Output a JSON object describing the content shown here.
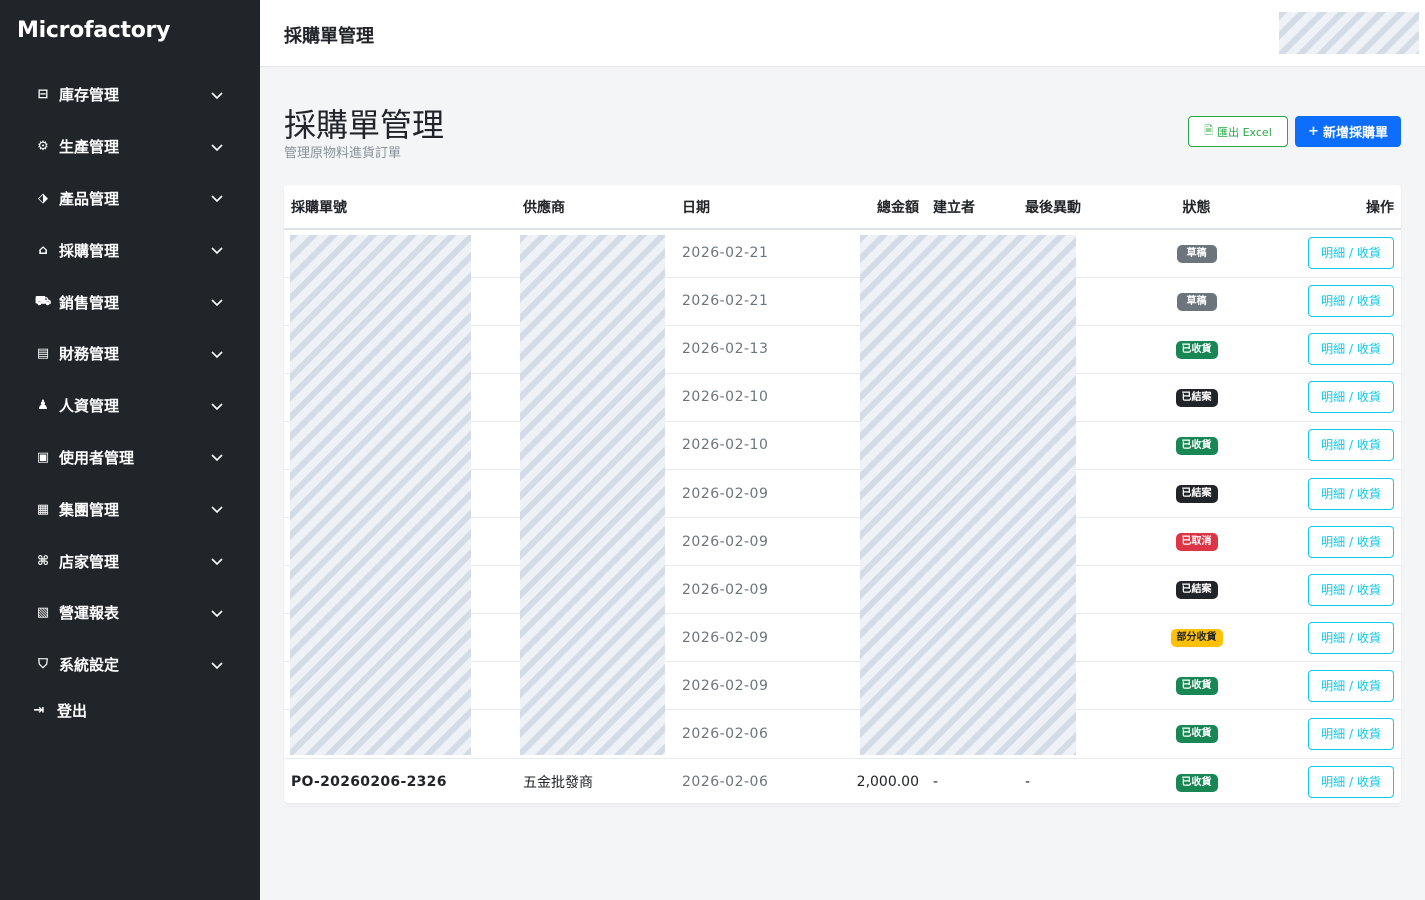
{
  "app": {
    "brand": "Microfactory"
  },
  "sidebar": {
    "items": [
      {
        "label": "庫存管理",
        "icon": "box-icon"
      },
      {
        "label": "生產管理",
        "icon": "gear-icon"
      },
      {
        "label": "產品管理",
        "icon": "tag-icon"
      },
      {
        "label": "採購管理",
        "icon": "building-icon"
      },
      {
        "label": "銷售管理",
        "icon": "cart-icon"
      },
      {
        "label": "財務管理",
        "icon": "ledger-icon"
      },
      {
        "label": "人資管理",
        "icon": "people-icon"
      },
      {
        "label": "使用者管理",
        "icon": "id-card-icon"
      },
      {
        "label": "集團管理",
        "icon": "document-icon"
      },
      {
        "label": "店家管理",
        "icon": "shop-icon"
      },
      {
        "label": "營運報表",
        "icon": "chart-icon"
      },
      {
        "label": "系統設定",
        "icon": "shield-icon"
      }
    ],
    "logout_label": "登出"
  },
  "topbar": {
    "title": "採購單管理"
  },
  "page": {
    "title": "採購單管理",
    "subtitle": "管理原物料進貨訂單",
    "export_label": "匯出 Excel",
    "new_label": "新增採購單"
  },
  "table": {
    "headers": [
      "採購單號",
      "供應商",
      "日期",
      "總金額",
      "建立者",
      "最後異動",
      "狀態",
      "操作"
    ],
    "rows": [
      {
        "po": "",
        "supplier": "",
        "date": "2026-02-21",
        "total": "",
        "creator": "",
        "modified": "",
        "status": "草稿",
        "action": "明細 / 收貨"
      },
      {
        "po": "",
        "supplier": "",
        "date": "2026-02-21",
        "total": "",
        "creator": "",
        "modified": "",
        "status": "草稿",
        "action": "明細 / 收貨"
      },
      {
        "po": "",
        "supplier": "",
        "date": "2026-02-13",
        "total": "",
        "creator": "",
        "modified": "",
        "status": "已收貨",
        "action": "明細 / 收貨"
      },
      {
        "po": "",
        "supplier": "",
        "date": "2026-02-10",
        "total": "",
        "creator": "",
        "modified": "",
        "status": "已結案",
        "action": "明細 / 收貨"
      },
      {
        "po": "",
        "supplier": "",
        "date": "2026-02-10",
        "total": "",
        "creator": "",
        "modified": "",
        "status": "已收貨",
        "action": "明細 / 收貨"
      },
      {
        "po": "",
        "supplier": "",
        "date": "2026-02-09",
        "total": "",
        "creator": "",
        "modified": "",
        "status": "已結案",
        "action": "明細 / 收貨"
      },
      {
        "po": "",
        "supplier": "",
        "date": "2026-02-09",
        "total": "",
        "creator": "",
        "modified": "",
        "status": "已取消",
        "action": "明細 / 收貨"
      },
      {
        "po": "",
        "supplier": "",
        "date": "2026-02-09",
        "total": "",
        "creator": "",
        "modified": "",
        "status": "已結案",
        "action": "明細 / 收貨"
      },
      {
        "po": "",
        "supplier": "",
        "date": "2026-02-09",
        "total": "",
        "creator": "",
        "modified": "",
        "status": "部分收貨",
        "action": "明細 / 收貨"
      },
      {
        "po": "",
        "supplier": "",
        "date": "2026-02-09",
        "total": "",
        "creator": "",
        "modified": "",
        "status": "已收貨",
        "action": "明細 / 收貨"
      },
      {
        "po": "",
        "supplier": "",
        "date": "2026-02-06",
        "total": "",
        "creator": "",
        "modified": "",
        "status": "已收貨",
        "action": "明細 / 收貨"
      },
      {
        "po": "PO-20260206-2326",
        "supplier": "五金批發商",
        "date": "2026-02-06",
        "total": "2,000.00",
        "creator": "-",
        "modified": "-",
        "status": "已收貨",
        "action": "明細 / 收貨"
      }
    ]
  },
  "status_colors": {
    "草稿": "#6c757d",
    "已收貨": "#198754",
    "已結案": "#212529",
    "已取消": "#dc3545",
    "部分收貨": "#ffc107"
  }
}
